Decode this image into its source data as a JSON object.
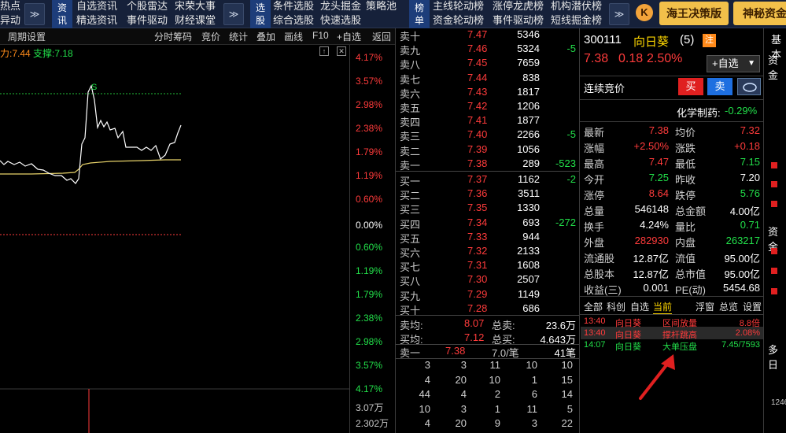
{
  "nav": {
    "col1": [
      "热点",
      "异动"
    ],
    "tag1": [
      "资",
      "讯"
    ],
    "col2": [
      "自选资讯",
      "精选资讯"
    ],
    "col3": [
      "个股雷达",
      "事件驱动"
    ],
    "col4": [
      "宋荣大事",
      "财经课堂"
    ],
    "tag2": [
      "选",
      "股"
    ],
    "col5": [
      "条件选股",
      "综合选股"
    ],
    "col6": [
      "龙头掘金",
      "快速选股"
    ],
    "col7": [
      "策略池",
      ""
    ],
    "tag3": [
      "榜",
      "单"
    ],
    "col8": [
      "主线轮动榜",
      "资金轮动榜"
    ],
    "col9": [
      "涨停龙虎榜",
      "事件驱动榜"
    ],
    "col10": [
      "机构潜伏榜",
      "短线掘金榜"
    ],
    "chevron": "≫",
    "k_logo": "K",
    "btn_gold1": "海王决策版",
    "btn_gold2": "神秘资金"
  },
  "toolbar": {
    "items": [
      "周期设置",
      "分时筹码",
      "竞价",
      "统计",
      "叠加",
      "画线",
      "F10",
      "+自选",
      "返回"
    ]
  },
  "chart": {
    "pressure_label": "力:7.44",
    "support_label": "支撑:7.18",
    "s_marker": "S",
    "pct_up": [
      "4.17%",
      "3.57%",
      "2.98%",
      "2.38%",
      "1.79%",
      "1.19%",
      "0.60%"
    ],
    "pct_zero": "0.00%",
    "pct_down": [
      "0.60%",
      "1.19%",
      "1.79%",
      "2.38%",
      "2.98%",
      "3.57%",
      "4.17%"
    ],
    "vol_labels": [
      "3.07万",
      "2.302万"
    ]
  },
  "order_book": {
    "asks": [
      {
        "label": "卖十",
        "price": "7.47",
        "vol": "5346",
        "chg": ""
      },
      {
        "label": "卖九",
        "price": "7.46",
        "vol": "5324",
        "chg": "-5"
      },
      {
        "label": "卖八",
        "price": "7.45",
        "vol": "7659",
        "chg": ""
      },
      {
        "label": "卖七",
        "price": "7.44",
        "vol": "838",
        "chg": ""
      },
      {
        "label": "卖六",
        "price": "7.43",
        "vol": "1817",
        "chg": ""
      },
      {
        "label": "卖五",
        "price": "7.42",
        "vol": "1206",
        "chg": ""
      },
      {
        "label": "卖四",
        "price": "7.41",
        "vol": "1877",
        "chg": ""
      },
      {
        "label": "卖三",
        "price": "7.40",
        "vol": "2266",
        "chg": "-5"
      },
      {
        "label": "卖二",
        "price": "7.39",
        "vol": "1056",
        "chg": ""
      },
      {
        "label": "卖一",
        "price": "7.38",
        "vol": "289",
        "chg": "-523"
      }
    ],
    "bids": [
      {
        "label": "买一",
        "price": "7.37",
        "vol": "1162",
        "chg": "-2"
      },
      {
        "label": "买二",
        "price": "7.36",
        "vol": "3511",
        "chg": ""
      },
      {
        "label": "买三",
        "price": "7.35",
        "vol": "1330",
        "chg": ""
      },
      {
        "label": "买四",
        "price": "7.34",
        "vol": "693",
        "chg": "-272"
      },
      {
        "label": "买五",
        "price": "7.33",
        "vol": "944",
        "chg": ""
      },
      {
        "label": "买六",
        "price": "7.32",
        "vol": "2133",
        "chg": ""
      },
      {
        "label": "买七",
        "price": "7.31",
        "vol": "1608",
        "chg": ""
      },
      {
        "label": "买八",
        "price": "7.30",
        "vol": "2507",
        "chg": ""
      },
      {
        "label": "买九",
        "price": "7.29",
        "vol": "1149",
        "chg": ""
      },
      {
        "label": "买十",
        "price": "7.28",
        "vol": "686",
        "chg": ""
      }
    ],
    "ask_avg_label": "卖均:",
    "ask_avg": "8.07",
    "ask_total_label": "总卖:",
    "ask_total": "23.6万",
    "bid_avg_label": "买均:",
    "bid_avg": "7.12",
    "bid_total_label": "总买:",
    "bid_total": "4.643万",
    "queue_label": "卖一",
    "queue_price": "7.38",
    "queue_per": "7.0/笔",
    "queue_count": "41笔",
    "queue_rows": [
      [
        "3",
        "3",
        "11",
        "10",
        "10"
      ],
      [
        "4",
        "20",
        "10",
        "1",
        "15"
      ],
      [
        "44",
        "4",
        "2",
        "6",
        "14"
      ],
      [
        "10",
        "3",
        "1",
        "11",
        "5"
      ],
      [
        "4",
        "20",
        "9",
        "3",
        "22"
      ]
    ]
  },
  "stock": {
    "code": "300111",
    "name": "向日葵",
    "count": "(5)",
    "badge": "注",
    "price": "7.38",
    "change": "0.18",
    "change_pct": "2.50%",
    "add_fav": "+自选",
    "auction_label": "连续竞价",
    "buy_btn": "买",
    "sell_btn": "卖",
    "sector": "化学制药:",
    "sector_pct": "-0.29%"
  },
  "quote": [
    {
      "l1": "最新",
      "v1": "7.38",
      "c1": "red",
      "l2": "均价",
      "v2": "7.32",
      "c2": "red"
    },
    {
      "l1": "涨幅",
      "v1": "+2.50%",
      "c1": "red",
      "l2": "涨跌",
      "v2": "+0.18",
      "c2": "red"
    },
    {
      "l1": "最高",
      "v1": "7.47",
      "c1": "red",
      "l2": "最低",
      "v2": "7.15",
      "c2": "green"
    },
    {
      "l1": "今开",
      "v1": "7.25",
      "c1": "green",
      "l2": "昨收",
      "v2": "7.20",
      "c2": "white"
    },
    {
      "l1": "涨停",
      "v1": "8.64",
      "c1": "red",
      "l2": "跌停",
      "v2": "5.76",
      "c2": "green"
    },
    {
      "l1": "总量",
      "v1": "546148",
      "c1": "white",
      "l2": "总金额",
      "v2": "4.00亿",
      "c2": "white"
    },
    {
      "l1": "换手",
      "v1": "4.24%",
      "c1": "white",
      "l2": "量比",
      "v2": "0.71",
      "c2": "green"
    },
    {
      "l1": "外盘",
      "v1": "282930",
      "c1": "red",
      "l2": "内盘",
      "v2": "263217",
      "c2": "green"
    },
    {
      "l1": "流通股",
      "v1": "12.87亿",
      "c1": "white",
      "l2": "流值",
      "v2": "95.00亿",
      "c2": "white"
    },
    {
      "l1": "总股本",
      "v1": "12.87亿",
      "c1": "white",
      "l2": "总市值",
      "v2": "95.00亿",
      "c2": "white"
    },
    {
      "l1": "收益(三)",
      "v1": "0.001",
      "c1": "white",
      "l2": "PE(动)",
      "v2": "5454.68",
      "c2": "white"
    }
  ],
  "news_tabs": [
    "全部",
    "科创",
    "自选",
    "当前",
    "浮窗",
    "总览",
    "设置"
  ],
  "news": [
    {
      "time": "13:40",
      "name": "向日葵",
      "event": "区间放量",
      "val": "8.8倍"
    },
    {
      "time": "13:40",
      "name": "向日葵",
      "event": "撑杆跳高",
      "val": "2.08%"
    },
    {
      "time": "14:07",
      "name": "向日葵",
      "event": "大单压盘",
      "val": "7.45/7593"
    }
  ],
  "far_right": {
    "tab": "基本",
    "a": "资金",
    "b": "资金",
    "c": "多日",
    "d": "1246"
  },
  "colors": {
    "accent_red": "#ff3b3b",
    "accent_green": "#22e04a",
    "price_line": "#ffffff",
    "avg_line": "#e8d36a",
    "gold": "#f2c04a"
  }
}
